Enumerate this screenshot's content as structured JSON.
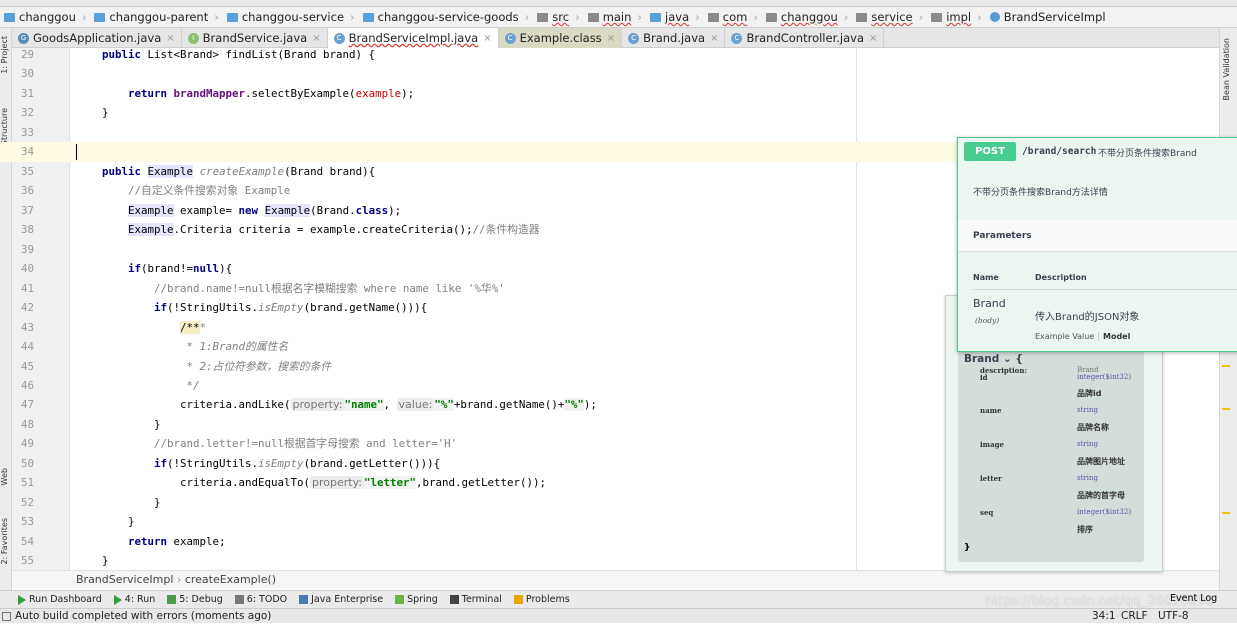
{
  "breadcrumb": [
    {
      "label": "changgou",
      "icon": "module-folder-icon"
    },
    {
      "label": "changgou-parent",
      "icon": "module-folder-icon"
    },
    {
      "label": "changgou-service",
      "icon": "module-folder-icon"
    },
    {
      "label": "changgou-service-goods",
      "icon": "module-folder-icon"
    },
    {
      "label": "src",
      "icon": "folder-icon"
    },
    {
      "label": "main",
      "icon": "folder-icon"
    },
    {
      "label": "java",
      "icon": "source-folder-icon"
    },
    {
      "label": "com",
      "icon": "package-icon"
    },
    {
      "label": "changgou",
      "icon": "package-icon"
    },
    {
      "label": "service",
      "icon": "package-icon"
    },
    {
      "label": "impl",
      "icon": "package-icon"
    },
    {
      "label": "BrandServiceImpl",
      "icon": "class-icon"
    }
  ],
  "tabs": [
    {
      "label": "GoodsApplication.java",
      "icon": "G"
    },
    {
      "label": "BrandService.java",
      "icon": "I"
    },
    {
      "label": "BrandServiceImpl.java",
      "icon": "C",
      "active": true
    },
    {
      "label": "Example.class",
      "icon": "C"
    },
    {
      "label": "Brand.java",
      "icon": "C"
    },
    {
      "label": "BrandController.java",
      "icon": "C"
    }
  ],
  "side_labels": {
    "project": "1: Project",
    "structure": "7: Structure",
    "web": "Web",
    "favorites": "2: Favorites",
    "bean_validation": "Bean Validation"
  },
  "code": [
    {
      "n": "29",
      "s": [
        [
          "",
          "    "
        ],
        [
          "kw",
          "public"
        ],
        [
          "",
          " List<Brand> findList(Brand brand) {"
        ]
      ]
    },
    {
      "n": "30",
      "s": []
    },
    {
      "n": "31",
      "s": [
        [
          "",
          "        "
        ],
        [
          "kw",
          "return "
        ],
        [
          "fd",
          "brandMapper"
        ],
        [
          "",
          ".selectByExample("
        ],
        [
          "pr",
          "example"
        ],
        [
          "",
          ");"
        ]
      ]
    },
    {
      "n": "32",
      "s": [
        [
          "",
          "    }"
        ]
      ]
    },
    {
      "n": "33",
      "s": []
    },
    {
      "n": "34",
      "s": [],
      "cur": true
    },
    {
      "n": "35",
      "s": [
        [
          "",
          "    "
        ],
        [
          "kw",
          "public "
        ],
        [
          "hl",
          "Example"
        ],
        [
          "",
          " "
        ],
        [
          "it",
          "createExample"
        ],
        [
          "",
          "(Brand brand){"
        ]
      ]
    },
    {
      "n": "36",
      "s": [
        [
          "",
          "        "
        ],
        [
          "cm",
          "//自定义条件搜索对象 Example"
        ]
      ]
    },
    {
      "n": "37",
      "s": [
        [
          "",
          "        "
        ],
        [
          "hl",
          "Example"
        ],
        [
          "",
          " example= "
        ],
        [
          "kw",
          "new "
        ],
        [
          "hl",
          "Example"
        ],
        [
          "",
          "(Brand."
        ],
        [
          "kw",
          "class"
        ],
        [
          "",
          ");"
        ]
      ]
    },
    {
      "n": "38",
      "s": [
        [
          "",
          "        "
        ],
        [
          "hl",
          "Example"
        ],
        [
          "",
          ".Criteria criteria = example.createCriteria();"
        ],
        [
          "cm",
          "//条件构造器"
        ]
      ]
    },
    {
      "n": "39",
      "s": []
    },
    {
      "n": "40",
      "s": [
        [
          "",
          "        "
        ],
        [
          "kw",
          "if"
        ],
        [
          "",
          "(brand!="
        ],
        [
          "kw",
          "null"
        ],
        [
          "",
          "){"
        ]
      ]
    },
    {
      "n": "41",
      "s": [
        [
          "",
          "            "
        ],
        [
          "cm",
          "//brand.name!=null根据名字模糊搜索 where name like '%华%'"
        ]
      ]
    },
    {
      "n": "42",
      "s": [
        [
          "",
          "            "
        ],
        [
          "kw",
          "if"
        ],
        [
          "",
          "(!StringUtils."
        ],
        [
          "it",
          "isEmpty"
        ],
        [
          "",
          "(brand.getName())){"
        ]
      ]
    },
    {
      "n": "43",
      "s": [
        [
          "",
          "                "
        ],
        [
          "docbg",
          "/**"
        ],
        [
          "doc",
          "*"
        ]
      ]
    },
    {
      "n": "44",
      "s": [
        [
          "",
          "                 "
        ],
        [
          "doc",
          "* 1:Brand的属性名"
        ]
      ]
    },
    {
      "n": "45",
      "s": [
        [
          "",
          "                 "
        ],
        [
          "doc",
          "* 2:占位符参数，搜索的条件"
        ]
      ]
    },
    {
      "n": "46",
      "s": [
        [
          "",
          "                 "
        ],
        [
          "doc",
          "*/"
        ]
      ]
    },
    {
      "n": "47",
      "s": [
        [
          "",
          "                criteria.andLike("
        ],
        [
          "hint",
          "property:"
        ],
        [
          "st",
          "\"name\""
        ],
        [
          "",
          ", "
        ],
        [
          "hint",
          "value:"
        ],
        [
          "st",
          "\"%\""
        ],
        [
          "",
          "+brand.getName()+"
        ],
        [
          "st",
          "\"%\""
        ],
        [
          "",
          ");"
        ]
      ]
    },
    {
      "n": "48",
      "s": [
        [
          "",
          "            }"
        ]
      ]
    },
    {
      "n": "49",
      "s": [
        [
          "",
          "            "
        ],
        [
          "cm",
          "//brand.letter!=null根据首字母搜索 and letter='H'"
        ]
      ]
    },
    {
      "n": "50",
      "s": [
        [
          "",
          "            "
        ],
        [
          "kw",
          "if"
        ],
        [
          "",
          "(!StringUtils."
        ],
        [
          "it",
          "isEmpty"
        ],
        [
          "",
          "(brand.getLetter())){"
        ]
      ]
    },
    {
      "n": "51",
      "s": [
        [
          "",
          "                criteria.andEqualTo("
        ],
        [
          "hint",
          "property:"
        ],
        [
          "st",
          "\"letter\""
        ],
        [
          "",
          ",brand.getLetter());"
        ]
      ]
    },
    {
      "n": "52",
      "s": [
        [
          "",
          "            }"
        ]
      ]
    },
    {
      "n": "53",
      "s": [
        [
          "",
          "        }"
        ]
      ]
    },
    {
      "n": "54",
      "s": [
        [
          "",
          "        "
        ],
        [
          "kw",
          "return "
        ],
        [
          "",
          "example;"
        ]
      ]
    },
    {
      "n": "55",
      "s": [
        [
          "",
          "    }"
        ]
      ]
    }
  ],
  "nav_breadcrumb": {
    "cls": "BrandServiceImpl",
    "method": "createExample()"
  },
  "tool_windows": [
    {
      "label": "Run Dashboard",
      "icon": "run-icon"
    },
    {
      "label": "4: Run",
      "icon": "run-icon"
    },
    {
      "label": "5: Debug",
      "icon": "debug-icon"
    },
    {
      "label": "6: TODO",
      "icon": "todo-icon"
    },
    {
      "label": "Java Enterprise",
      "icon": "java-enterprise-icon"
    },
    {
      "label": "Spring",
      "icon": "spring-icon"
    },
    {
      "label": "Terminal",
      "icon": "terminal-icon"
    },
    {
      "label": "Problems",
      "icon": "warning-icon"
    }
  ],
  "event_log": "Event Log",
  "status": {
    "message": "Auto build completed with errors (moments ago)",
    "position": "34:1",
    "line_sep": "CRLF",
    "encoding": "UTF-8"
  },
  "watermark": "https://blog.csdn.net/qq_36026890",
  "swagger": {
    "method": "POST",
    "path": "/brand/search",
    "summary": "不带分页条件搜索Brand",
    "description": "不带分页条件搜索Brand方法详情",
    "parameters_title": "Parameters",
    "col_name": "Name",
    "col_desc": "Description",
    "param": {
      "name": "Brand",
      "in": "(body)",
      "desc": "传入Brand的JSON对象"
    },
    "example_value": "Example Value",
    "model": "Model",
    "model_box": {
      "title": "Brand ⌄ {",
      "description_key": "description:",
      "description_val": "Brand",
      "close": "}",
      "fields": [
        {
          "name": "id",
          "type": "integer($int32)",
          "desc": "品牌id"
        },
        {
          "name": "name",
          "type": "string",
          "desc": "品牌名称"
        },
        {
          "name": "image",
          "type": "string",
          "desc": "品牌图片地址"
        },
        {
          "name": "letter",
          "type": "string",
          "desc": "品牌的首字母"
        },
        {
          "name": "seq",
          "type": "integer($int32)",
          "desc": "排序"
        }
      ]
    }
  },
  "colors": {
    "post": "#49cc90",
    "keyword": "#000080",
    "string": "#008000",
    "comment": "#808080",
    "current_line": "#fffae3"
  }
}
